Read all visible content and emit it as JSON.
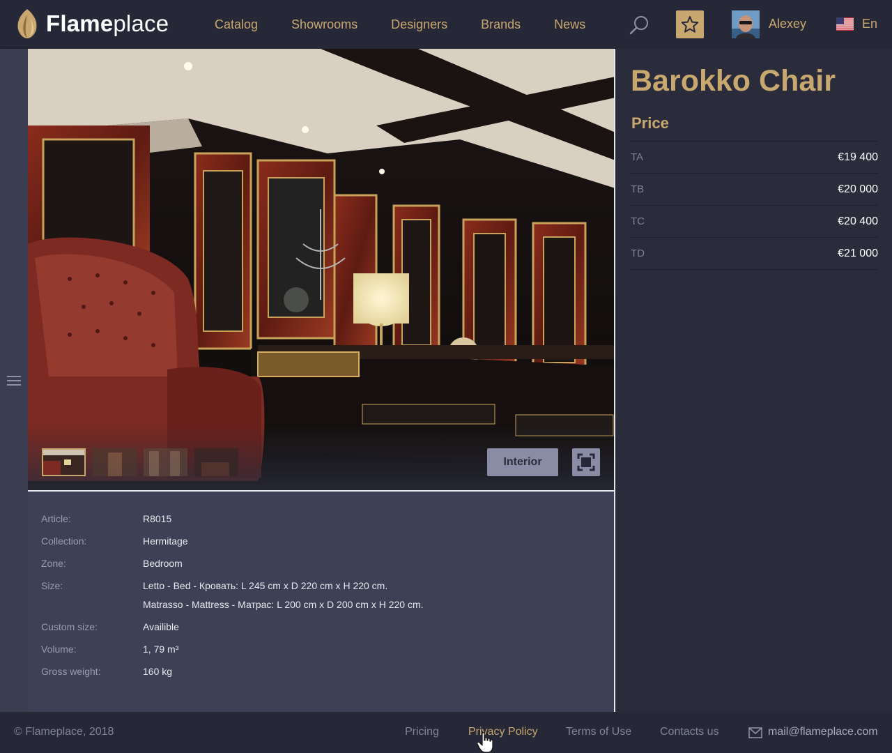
{
  "header": {
    "logo_bold": "Flame",
    "logo_light": "place",
    "nav": [
      "Catalog",
      "Showrooms",
      "Designers",
      "Brands",
      "News"
    ],
    "user_name": "Alexey",
    "language": "En",
    "icons": [
      "flame-logo-icon",
      "search-icon",
      "star-icon",
      "us-flag-icon"
    ]
  },
  "gallery": {
    "interior_label": "Interior",
    "thumbnail_count": 4
  },
  "product": {
    "title": "Barokko Chair",
    "price_heading": "Price",
    "prices": [
      {
        "code": "TA",
        "amount": "€19 400"
      },
      {
        "code": "TB",
        "amount": "€20 000"
      },
      {
        "code": "TC",
        "amount": "€20 400"
      },
      {
        "code": "TD",
        "amount": "€21 000"
      }
    ]
  },
  "specs": [
    {
      "label": "Article:",
      "lines": [
        "R8015"
      ]
    },
    {
      "label": "Collection:",
      "lines": [
        "Hermitage"
      ]
    },
    {
      "label": "Zone:",
      "lines": [
        "Bedroom"
      ]
    },
    {
      "label": "Size:",
      "lines": [
        "Letto - Bed - Кровать: L 245 cm x D 220 cm x H 220 cm.",
        "Matrasso - Mattress - Матрас: L 200 cm x D 200 cm x H 220 cm."
      ]
    },
    {
      "label": "Custom size:",
      "lines": [
        "Availible"
      ]
    },
    {
      "label": "Volume:",
      "lines": [
        "1, 79 m³"
      ]
    },
    {
      "label": "Gross weight:",
      "lines": [
        "160 kg"
      ]
    }
  ],
  "footer": {
    "copyright": "© Flameplace, 2018",
    "links": [
      "Pricing",
      "Privacy Policy",
      "Terms of Use",
      "Contacts us"
    ],
    "active_link": "Privacy Policy",
    "email": "mail@flameplace.com"
  },
  "colors": {
    "accent": "#c9a870",
    "header_bg": "#262838",
    "page_bg": "#2a2c3b",
    "specs_bg": "#3d4156",
    "button_bg": "#8a8ca5"
  }
}
